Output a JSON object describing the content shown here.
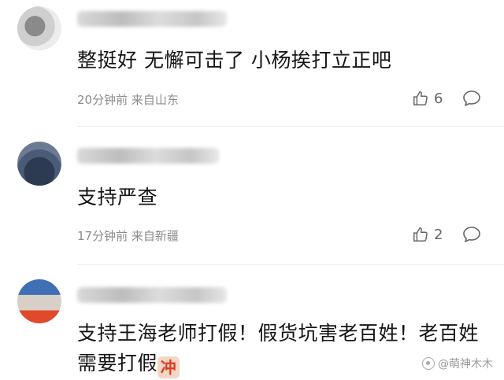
{
  "comments": [
    {
      "content": "整挺好 无懈可击了 小杨挨打立正吧",
      "time": "20分钟前",
      "location": "来自山东",
      "likes": "6"
    },
    {
      "content": "支持严查",
      "time": "17分钟前",
      "location": "来自新疆",
      "likes": "2"
    },
    {
      "content": "支持王海老师打假！假货坑害老百姓！老百姓需要打假",
      "emoji": "冲"
    }
  ],
  "watermark": "@萌神木木",
  "icons": {
    "like": "thumbs-up-icon",
    "reply": "speech-bubble-icon"
  }
}
